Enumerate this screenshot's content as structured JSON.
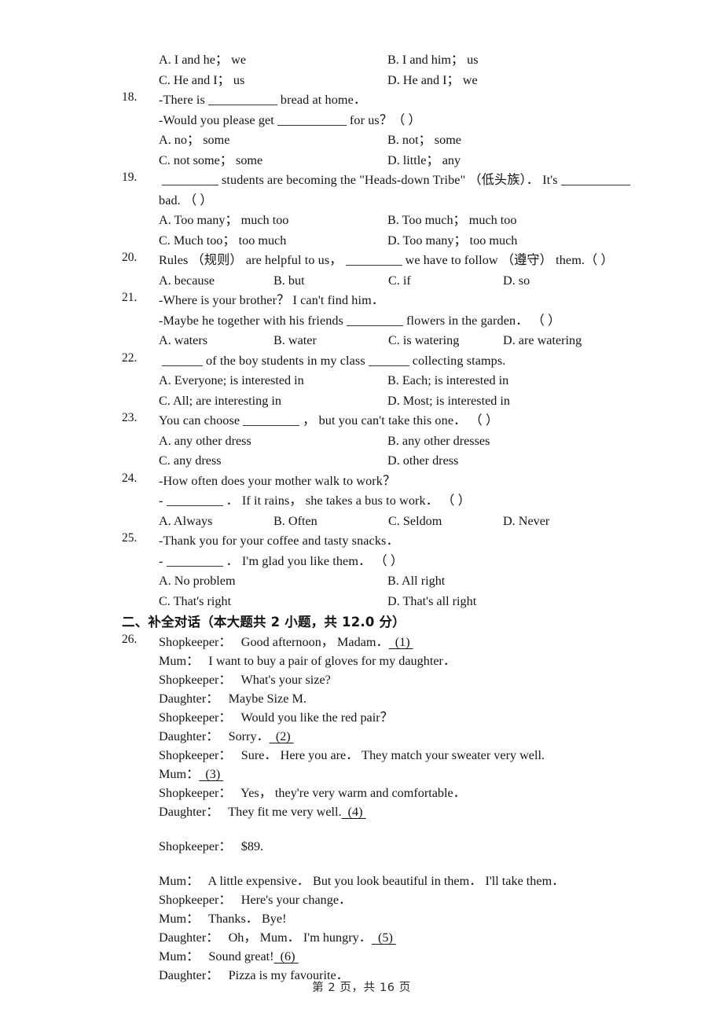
{
  "page": {
    "footer": "第 2 页，共 16 页"
  },
  "q17_options": {
    "a": "A. I and he；  we",
    "b": "B. I and him；  us",
    "c": "C. He and I；  us",
    "d": "D. He and I；  we"
  },
  "questions": [
    {
      "number": "18.",
      "lines": [
        {
          "pre": "-There is",
          "blank": "b-lg",
          "post": "bread at home．"
        },
        {
          "pre": "-Would you please get",
          "blank": "b-lg",
          "post": "for us？（    ）"
        }
      ],
      "options_layout": "2col",
      "options": [
        "A. no；  some",
        "B. not；  some",
        "C. not some；  some",
        "D. little；  any"
      ]
    },
    {
      "number": "19.",
      "lines": [
        {
          "pre": "",
          "blank": "b-md",
          "post": "students are becoming the \"Heads-down Tribe\" （低头族）．  It's",
          "blank2": "b-lg"
        },
        {
          "pre": "bad.  （    ）",
          "blank": "",
          "post": ""
        }
      ],
      "options_layout": "2col",
      "options": [
        "A. Too many；  much too",
        "B. Too much；  much too",
        "C. Much too；  too much",
        "D. Too many；  too much"
      ]
    },
    {
      "number": "20.",
      "lines": [
        {
          "pre": "Rules （规则） are helpful to us，",
          "blank": "b-md",
          "post": "we have to follow （遵守） them.（    ）"
        }
      ],
      "options_layout": "4col",
      "options": [
        "A. because",
        "B. but",
        "C. if",
        "D. so"
      ]
    },
    {
      "number": "21.",
      "lines": [
        {
          "pre": "-Where is your brother？  I can't find him．",
          "blank": "",
          "post": ""
        },
        {
          "pre": "-Maybe he together with his friends",
          "blank": "b-md",
          "post": "flowers in the garden．  （    ）"
        }
      ],
      "options_layout": "4col",
      "options": [
        "A. waters",
        "B. water",
        "C. is watering",
        "D. are watering"
      ]
    },
    {
      "number": "22.",
      "lines": [
        {
          "pre": "",
          "blank": "b-sm",
          "post": "of the boy students in my class",
          "blank2": "b-sm",
          "post2": "collecting stamps."
        }
      ],
      "options_layout": "2col",
      "options": [
        "A. Everyone; is interested in",
        "B. Each; is interested in",
        "C. All; are interesting in",
        "D. Most; is interested in"
      ]
    },
    {
      "number": "23.",
      "lines": [
        {
          "pre": "You can choose",
          "blank": "b-md",
          "post": "，  but you can't take this one．  （    ）"
        }
      ],
      "options_layout": "2col",
      "options": [
        "A. any other dress",
        "B. any other dresses",
        "C. any dress",
        "D. other dress"
      ]
    },
    {
      "number": "24.",
      "lines": [
        {
          "pre": "-How often does your mother walk to work？",
          "blank": "",
          "post": ""
        },
        {
          "pre": "-",
          "blank": "b-md",
          "post": "．  If it rains，  she takes a bus to work．  （    ）"
        }
      ],
      "options_layout": "4col",
      "options": [
        "A. Always",
        "B. Often",
        "C. Seldom",
        "D. Never"
      ]
    },
    {
      "number": "25.",
      "lines": [
        {
          "pre": "-Thank you for your coffee and tasty snacks．",
          "blank": "",
          "post": ""
        },
        {
          "pre": "-",
          "blank": "b-md",
          "post": "．  I'm glad you like them．  （    ）"
        }
      ],
      "options_layout": "2col",
      "options": [
        "A. No problem",
        "B. All right",
        "C. That's right",
        "D. That's all right"
      ]
    }
  ],
  "section2": {
    "heading": "二、补全对话（本大题共 2 小题，共 12.0 分）",
    "number": "26.",
    "dialogue": [
      {
        "speaker": "Shopkeeper：",
        "text": "Good afternoon，  Madam．",
        "mark": "(1)",
        "gap_after": false
      },
      {
        "speaker": "Mum：",
        "text": "I want to buy a pair of gloves for my daughter．",
        "mark": "",
        "gap_after": false
      },
      {
        "speaker": "Shopkeeper：",
        "text": "What's your size?",
        "mark": "",
        "gap_after": false
      },
      {
        "speaker": "Daughter：",
        "text": "Maybe Size M.",
        "mark": "",
        "gap_after": false
      },
      {
        "speaker": "Shopkeeper：",
        "text": "Would you like the red pair？",
        "mark": "",
        "gap_after": false
      },
      {
        "speaker": "Daughter：",
        "text": "Sorry．",
        "mark": "(2)",
        "gap_after": false
      },
      {
        "speaker": "Shopkeeper：",
        "text": "Sure．  Here you are．  They match your sweater very well.",
        "mark": "",
        "gap_after": false
      },
      {
        "speaker": "Mum：",
        "text": "",
        "mark": "(3)",
        "gap_after": false
      },
      {
        "speaker": "Shopkeeper：",
        "text": "Yes，  they're very warm and comfortable．",
        "mark": "",
        "gap_after": false
      },
      {
        "speaker": "Daughter：",
        "text": "They fit me very well.",
        "mark": "(4)",
        "gap_after": true
      },
      {
        "speaker": "Shopkeeper：",
        "text": "$89.",
        "mark": "",
        "gap_after": true
      },
      {
        "speaker": "Mum：",
        "text": "A little expensive．  But you look beautiful in them．  I'll take them．",
        "mark": "",
        "gap_after": false
      },
      {
        "speaker": "Shopkeeper：",
        "text": "Here's your change．",
        "mark": "",
        "gap_after": false
      },
      {
        "speaker": "Mum：",
        "text": "Thanks．  Bye!",
        "mark": "",
        "gap_after": false
      },
      {
        "speaker": "Daughter：",
        "text": "Oh，  Mum．  I'm hungry．",
        "mark": "(5)",
        "gap_after": false
      },
      {
        "speaker": "Mum：",
        "text": "Sound great!",
        "mark": "(6)",
        "gap_after": false
      },
      {
        "speaker": "Daughter：",
        "text": "Pizza is my favourite．",
        "mark": "",
        "gap_after": false
      }
    ]
  }
}
